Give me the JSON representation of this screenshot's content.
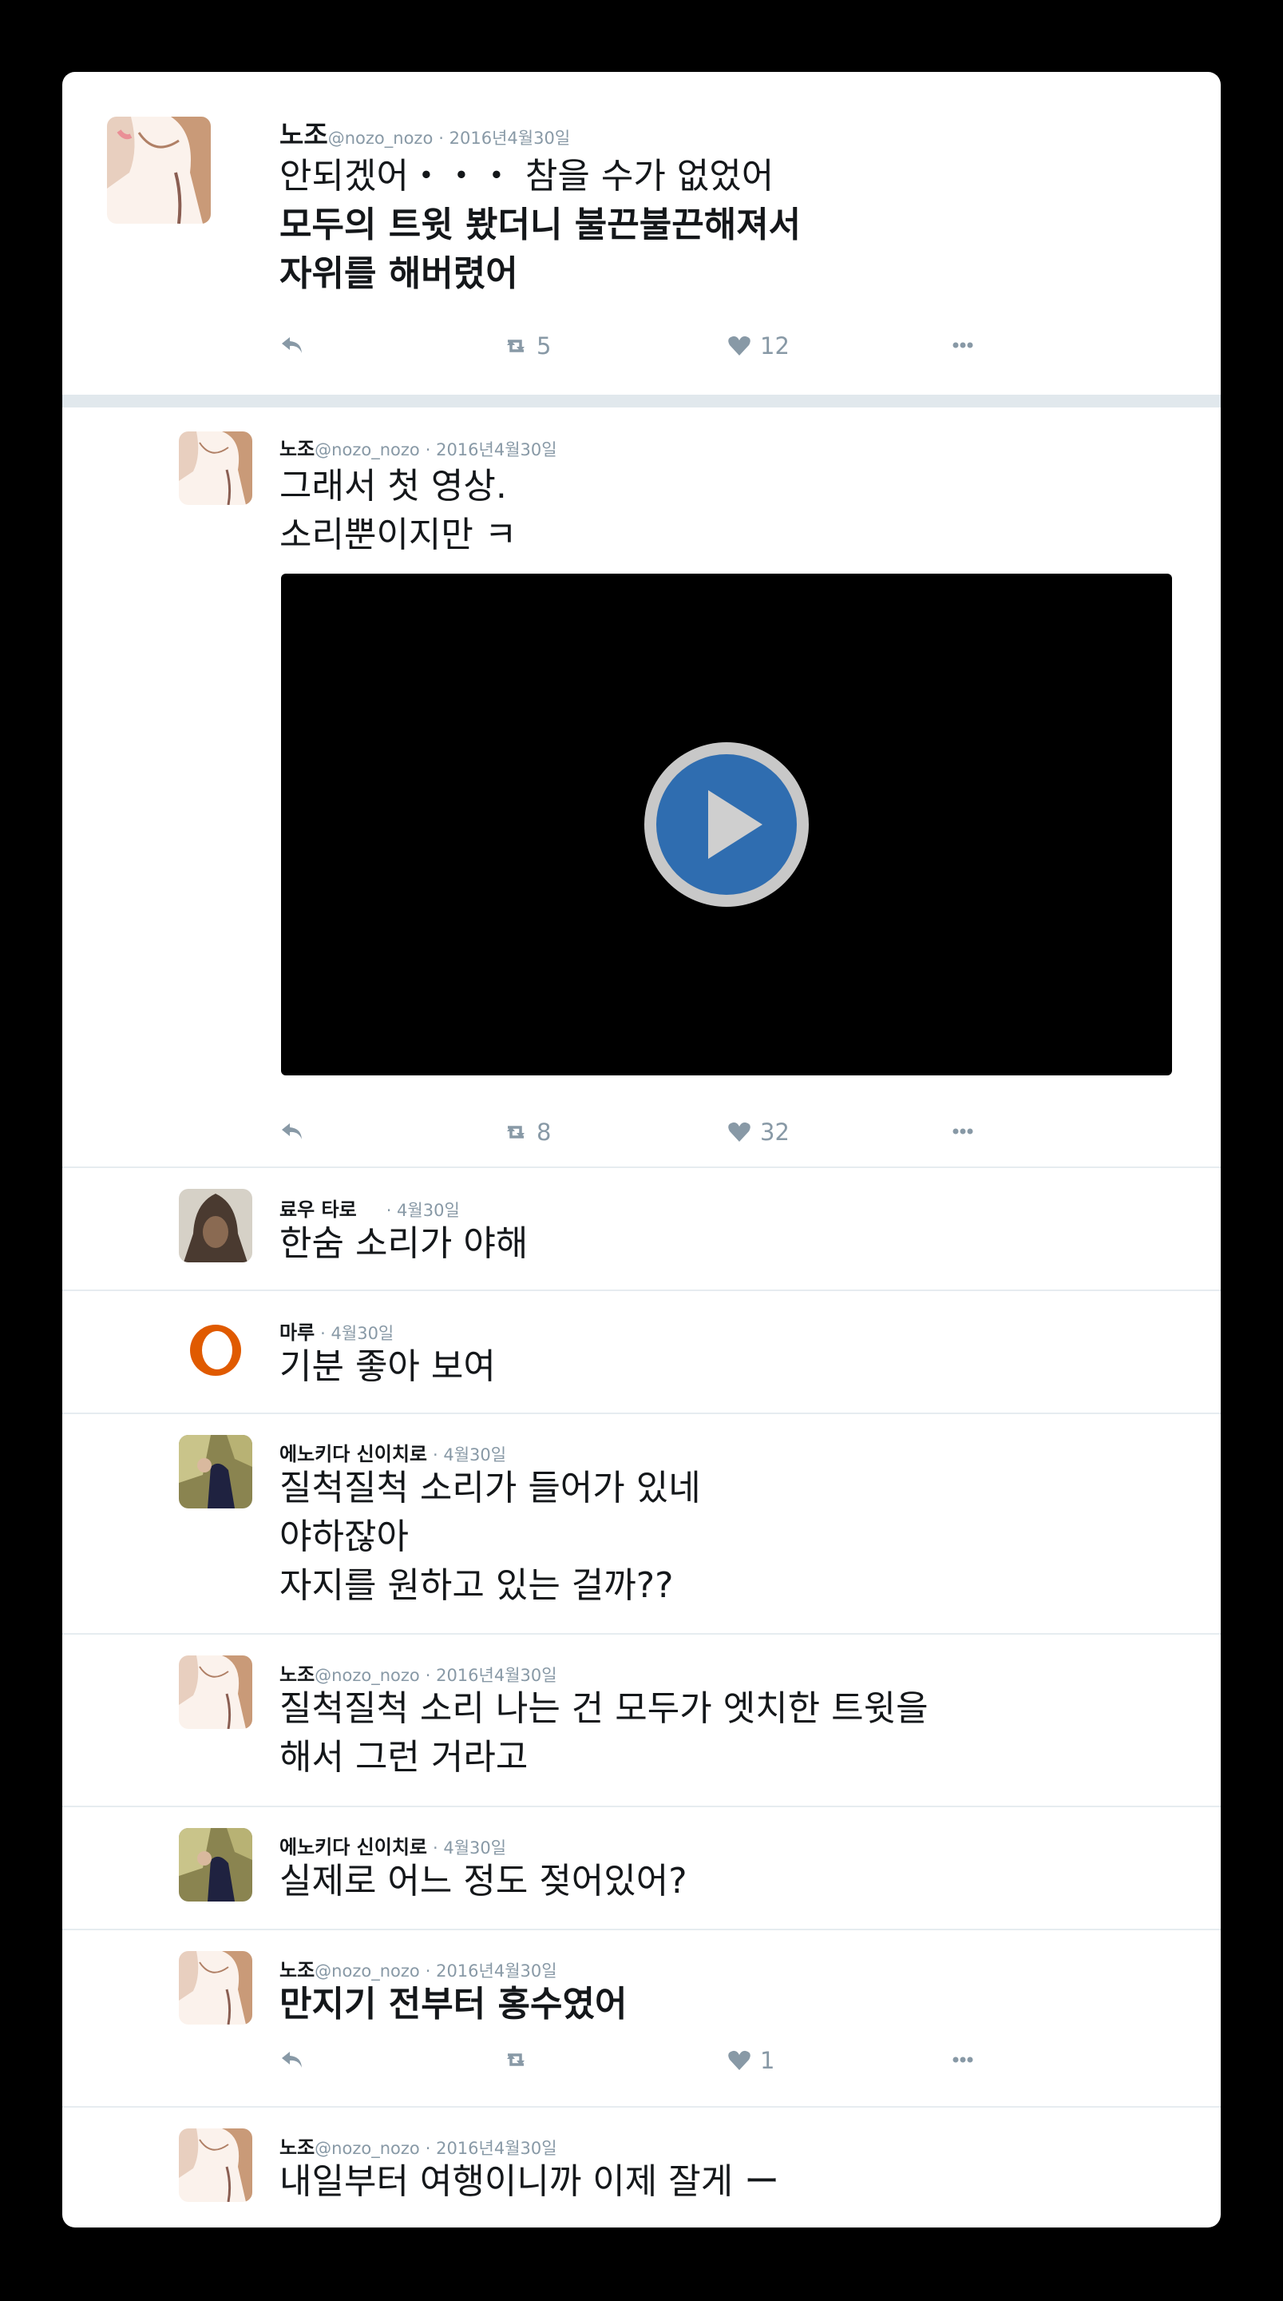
{
  "tweets": [
    {
      "name": "노조",
      "handle": "@nozo_nozo",
      "date": "· 2016년4월30일",
      "lines": [
        "안되겠어・・・ 참을 수가 없었어",
        "모두의 트윗 봤더니 불끈불끈해져서",
        "자위를 해버렸어"
      ],
      "retweets": "5",
      "likes": "12"
    },
    {
      "name": "노조",
      "handle": "@nozo_nozo",
      "date": "· 2016년4월30일",
      "lines": [
        "그래서 첫 영상.",
        "소리뿐이지만 ㅋ"
      ],
      "retweets": "8",
      "likes": "32"
    },
    {
      "name": "료우 타로",
      "date": "· 4월30일",
      "lines": [
        "한숨 소리가 야해"
      ]
    },
    {
      "name": "마루",
      "date": "· 4월30일",
      "lines": [
        "기분 좋아 보여"
      ]
    },
    {
      "name": "에노키다 신이치로",
      "date": "· 4월30일",
      "lines": [
        "질척질척 소리가 들어가 있네",
        "야하잖아",
        "자지를 원하고 있는 걸까??"
      ]
    },
    {
      "name": "노조",
      "handle": "@nozo_nozo",
      "date": "· 2016년4월30일",
      "lines": [
        "질척질척 소리 나는 건 모두가 엣치한 트윗을",
        "해서 그런 거라고"
      ]
    },
    {
      "name": "에노키다 신이치로",
      "date": "· 4월30일",
      "lines": [
        "실제로 어느 정도 젖어있어?"
      ]
    },
    {
      "name": "노조",
      "handle": "@nozo_nozo",
      "date": "· 2016년4월30일",
      "lines": [
        "만지기 전부터 홍수였어"
      ],
      "retweets": "",
      "likes": "1"
    },
    {
      "name": "노조",
      "handle": "@nozo_nozo",
      "date": "· 2016년4월30일",
      "lines": [
        "내일부터 여행이니까 이제 잘게 ー"
      ]
    }
  ],
  "icons": {
    "reply": "reply-icon",
    "retweet": "retweet-icon",
    "like": "heart-icon",
    "more": "more-icon",
    "play": "play-icon"
  },
  "colors": {
    "background": "#000000",
    "card": "#ffffff",
    "icon": "#8899a6",
    "play_button": "#2f6db0"
  }
}
